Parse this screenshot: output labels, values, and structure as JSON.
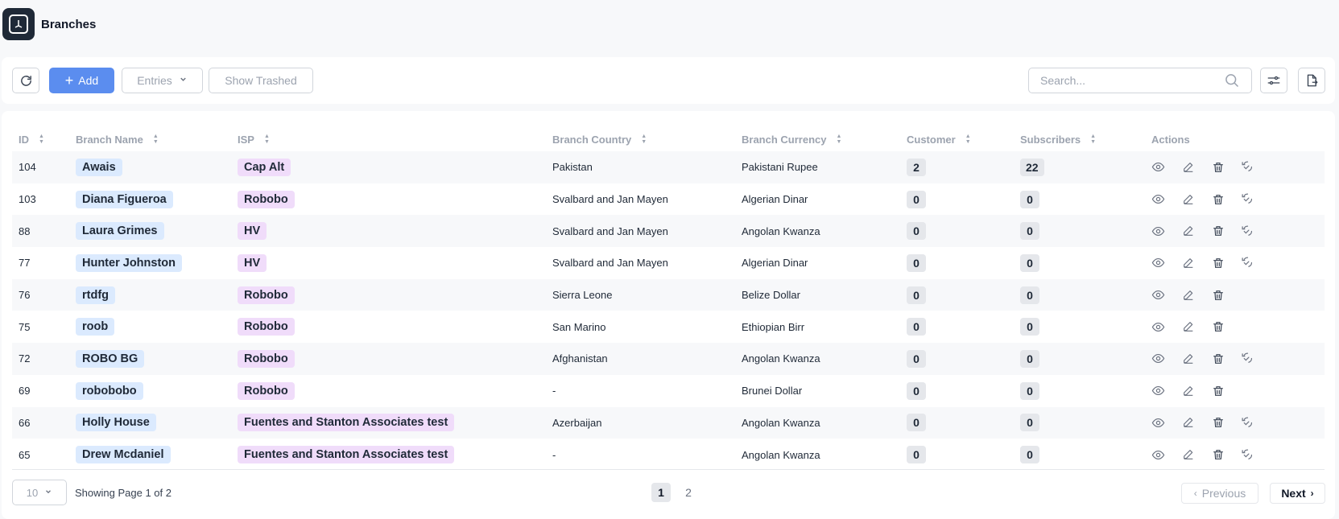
{
  "header": {
    "title": "Branches",
    "logo_icon": "app-logo-icon"
  },
  "toolbar": {
    "refresh_icon": "refresh-icon",
    "add_label": "Add",
    "entries_label": "Entries",
    "trashed_label": "Show Trashed",
    "search_placeholder": "Search...",
    "filter_icon": "sliders-icon",
    "export_icon": "export-icon"
  },
  "table": {
    "headers": {
      "id": "ID",
      "name": "Branch Name",
      "isp": "ISP",
      "country": "Branch Country",
      "currency": "Branch Currency",
      "customer": "Customer",
      "subscribers": "Subscribers",
      "actions": "Actions"
    },
    "rows": [
      {
        "id": "104",
        "name": "Awais",
        "isp": "Cap Alt",
        "country": "Pakistan",
        "currency": "Pakistani Rupee",
        "customer": "2",
        "subscribers": "22",
        "restore": true
      },
      {
        "id": "103",
        "name": "Diana Figueroa",
        "isp": "Robobo",
        "country": "Svalbard and Jan Mayen",
        "currency": "Algerian Dinar",
        "customer": "0",
        "subscribers": "0",
        "restore": true
      },
      {
        "id": "88",
        "name": "Laura Grimes",
        "isp": "HV",
        "country": "Svalbard and Jan Mayen",
        "currency": "Angolan Kwanza",
        "customer": "0",
        "subscribers": "0",
        "restore": true
      },
      {
        "id": "77",
        "name": "Hunter Johnston",
        "isp": "HV",
        "country": "Svalbard and Jan Mayen",
        "currency": "Algerian Dinar",
        "customer": "0",
        "subscribers": "0",
        "restore": true
      },
      {
        "id": "76",
        "name": "rtdfg",
        "isp": "Robobo",
        "country": "Sierra Leone",
        "currency": "Belize Dollar",
        "customer": "0",
        "subscribers": "0",
        "restore": false
      },
      {
        "id": "75",
        "name": "roob",
        "isp": "Robobo",
        "country": "San Marino",
        "currency": "Ethiopian Birr",
        "customer": "0",
        "subscribers": "0",
        "restore": false
      },
      {
        "id": "72",
        "name": "ROBO BG",
        "isp": "Robobo",
        "country": "Afghanistan",
        "currency": "Angolan Kwanza",
        "customer": "0",
        "subscribers": "0",
        "restore": true
      },
      {
        "id": "69",
        "name": "robobobo",
        "isp": "Robobo",
        "country": "-",
        "currency": "Brunei Dollar",
        "customer": "0",
        "subscribers": "0",
        "restore": false
      },
      {
        "id": "66",
        "name": "Holly House",
        "isp": "Fuentes and Stanton Associates test",
        "country": "Azerbaijan",
        "currency": "Angolan Kwanza",
        "customer": "0",
        "subscribers": "0",
        "restore": true
      },
      {
        "id": "65",
        "name": "Drew Mcdaniel",
        "isp": "Fuentes and Stanton Associates test",
        "country": "-",
        "currency": "Angolan Kwanza",
        "customer": "0",
        "subscribers": "0",
        "restore": true
      }
    ]
  },
  "footer": {
    "page_size": "10",
    "showing": "Showing Page 1 of 2",
    "pages": [
      "1",
      "2"
    ],
    "current_page": "1",
    "prev_label": "Previous",
    "next_label": "Next"
  },
  "colors": {
    "accent": "#5b8def",
    "name_chip": "#dbeafe",
    "isp_chip": "#f0dcfa",
    "count_chip": "#e5e7eb"
  }
}
